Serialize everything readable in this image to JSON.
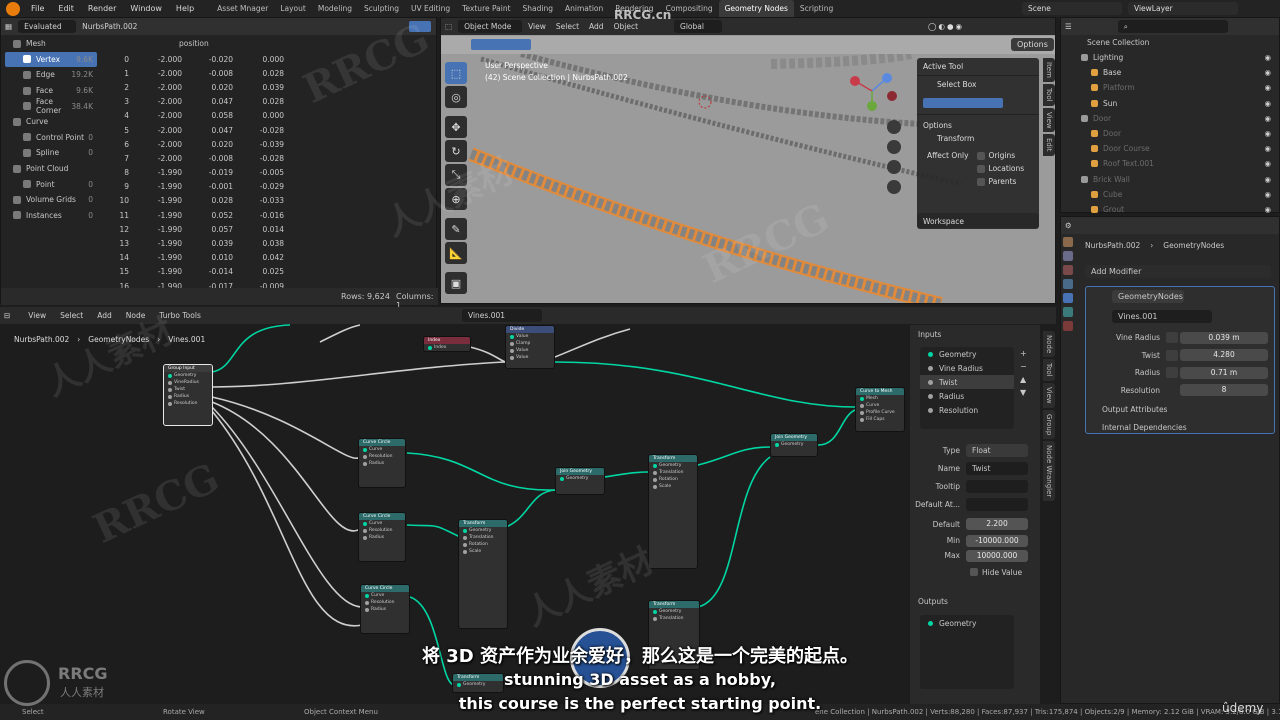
{
  "menu": [
    "File",
    "Edit",
    "Render",
    "Window",
    "Help"
  ],
  "workspaces": [
    "Asset Mnager",
    "Layout",
    "Modeling",
    "Sculpting",
    "UV Editing",
    "Texture Paint",
    "Shading",
    "Animation",
    "Rendering",
    "Compositing",
    "Geometry Nodes",
    "Scripting"
  ],
  "active_workspace": "Geometry Nodes",
  "scene": "Scene",
  "view_layer": "ViewLayer",
  "spreadsheet": {
    "mode": "Evaluated",
    "object": "NurbsPath.002",
    "column": "position",
    "tree": [
      {
        "label": "Mesh",
        "count": "",
        "level": 0
      },
      {
        "label": "Vertex",
        "count": "9.6K",
        "level": 1,
        "selected": true
      },
      {
        "label": "Edge",
        "count": "19.2K",
        "level": 1
      },
      {
        "label": "Face",
        "count": "9.6K",
        "level": 1
      },
      {
        "label": "Face Corner",
        "count": "38.4K",
        "level": 1
      },
      {
        "label": "Curve",
        "count": "",
        "level": 0
      },
      {
        "label": "Control Point",
        "count": "0",
        "level": 1
      },
      {
        "label": "Spline",
        "count": "0",
        "level": 1
      },
      {
        "label": "Point Cloud",
        "count": "",
        "level": 0
      },
      {
        "label": "Point",
        "count": "0",
        "level": 1
      },
      {
        "label": "Volume Grids",
        "count": "0",
        "level": 0
      },
      {
        "label": "Instances",
        "count": "0",
        "level": 0
      }
    ],
    "rows": [
      [
        "0",
        "-2.000",
        "-0.020",
        "0.000"
      ],
      [
        "1",
        "-2.000",
        "-0.008",
        "0.028"
      ],
      [
        "2",
        "-2.000",
        "0.020",
        "0.039"
      ],
      [
        "3",
        "-2.000",
        "0.047",
        "0.028"
      ],
      [
        "4",
        "-2.000",
        "0.058",
        "0.000"
      ],
      [
        "5",
        "-2.000",
        "0.047",
        "-0.028"
      ],
      [
        "6",
        "-2.000",
        "0.020",
        "-0.039"
      ],
      [
        "7",
        "-2.000",
        "-0.008",
        "-0.028"
      ],
      [
        "8",
        "-1.990",
        "-0.019",
        "-0.005"
      ],
      [
        "9",
        "-1.990",
        "-0.001",
        "-0.029"
      ],
      [
        "10",
        "-1.990",
        "0.028",
        "-0.033"
      ],
      [
        "11",
        "-1.990",
        "0.052",
        "-0.016"
      ],
      [
        "12",
        "-1.990",
        "0.057",
        "0.014"
      ],
      [
        "13",
        "-1.990",
        "0.039",
        "0.038"
      ],
      [
        "14",
        "-1.990",
        "0.010",
        "0.042"
      ],
      [
        "15",
        "-1.990",
        "-0.014",
        "0.025"
      ],
      [
        "16",
        "-1.990",
        "-0.017",
        "-0.009"
      ]
    ],
    "rows_count": "Rows: 9,624",
    "columns_count": "Columns: 1"
  },
  "viewport": {
    "mode": "Object Mode",
    "menu": [
      "View",
      "Select",
      "Add",
      "Object"
    ],
    "orientation": "Global",
    "options": "Options",
    "perspective": "User Perspective",
    "collection_line": "(42) Scene Collection | NurbsPath.002",
    "active_tool_title": "Active Tool",
    "active_tool": "Select Box",
    "options_title": "Options",
    "transform": "Transform",
    "affect_only": "Affect Only",
    "checks": [
      "Origins",
      "Locations",
      "Parents"
    ],
    "workspace": "Workspace",
    "side_tabs": [
      "Item",
      "Tool",
      "View",
      "Edit"
    ]
  },
  "outliner": {
    "title": "Scene Collection",
    "items": [
      {
        "label": "Lighting",
        "level": 1,
        "dim": false
      },
      {
        "label": "Base",
        "level": 2,
        "dim": false
      },
      {
        "label": "Platform",
        "level": 2,
        "dim": true
      },
      {
        "label": "Sun",
        "level": 2,
        "dim": false
      },
      {
        "label": "Door",
        "level": 1,
        "dim": true
      },
      {
        "label": "Door",
        "level": 2,
        "dim": true
      },
      {
        "label": "Door Course",
        "level": 2,
        "dim": true
      },
      {
        "label": "Roof Text.001",
        "level": 2,
        "dim": true
      },
      {
        "label": "Brick Wall",
        "level": 1,
        "dim": true
      },
      {
        "label": "Cube",
        "level": 2,
        "dim": true
      },
      {
        "label": "Grout",
        "level": 2,
        "dim": true
      }
    ]
  },
  "properties": {
    "object": "NurbsPath.002",
    "modifier_name": "GeometryNodes",
    "add_modifier": "Add Modifier",
    "node_group": "Vines.001",
    "params": [
      {
        "label": "Vine Radius",
        "value": "0.039 m"
      },
      {
        "label": "Twist",
        "value": "4.280"
      },
      {
        "label": "Radius",
        "value": "0.71 m"
      },
      {
        "label": "Resolution",
        "value": "8"
      }
    ],
    "output_attributes": "Output Attributes",
    "internal_dependencies": "Internal Dependencies"
  },
  "node_editor": {
    "menu": [
      "View",
      "Select",
      "Add",
      "Node",
      "Turbo Tools"
    ],
    "breadcrumb": [
      "NurbsPath.002",
      "GeometryNodes",
      "Vines.001"
    ],
    "group_name": "Vines.001",
    "nodes": [
      {
        "title": "Group Input",
        "color": "#3b3b3b",
        "sockets": [
          "Geometry",
          "VineRadius",
          "Twist",
          "Radius",
          "Resolution"
        ]
      },
      {
        "title": "Curve Circle",
        "color": "#2d6b6b",
        "sockets": [
          "Curve",
          "Resolution",
          "Radius"
        ]
      },
      {
        "title": "Curve Circle",
        "color": "#2d6b6b",
        "sockets": [
          "Curve",
          "Resolution",
          "Radius"
        ]
      },
      {
        "title": "Curve Circle",
        "color": "#2d6b6b",
        "sockets": [
          "Curve",
          "Resolution",
          "Radius"
        ]
      },
      {
        "title": "Join Geometry",
        "color": "#2d6b6b",
        "sockets": [
          "Geometry"
        ]
      },
      {
        "title": "Transform",
        "color": "#2d6b6b",
        "sockets": [
          "Geometry",
          "Translation",
          "Rotation",
          "Scale"
        ]
      },
      {
        "title": "Transform",
        "color": "#2d6b6b",
        "sockets": [
          "Geometry",
          "Translation",
          "Rotation",
          "Scale"
        ]
      },
      {
        "title": "Transform",
        "color": "#2d6b6b",
        "sockets": [
          "Geometry",
          "Translation"
        ]
      },
      {
        "title": "Join Geometry",
        "color": "#2d6b6b",
        "sockets": [
          "Geometry"
        ]
      },
      {
        "title": "Curve to Mesh",
        "color": "#2d6b6b",
        "sockets": [
          "Mesh",
          "Curve",
          "Profile Curve",
          "Fill Caps"
        ]
      },
      {
        "title": "Divide",
        "color": "#3d4d7a",
        "sockets": [
          "Value",
          "Clamp",
          "Value",
          "Value"
        ]
      },
      {
        "title": "Index",
        "color": "#7a2d3d",
        "sockets": [
          "Index"
        ]
      },
      {
        "title": "Transform",
        "color": "#2d6b6b",
        "sockets": [
          "Geometry"
        ]
      }
    ],
    "side_tabs": [
      "Node",
      "Tool",
      "View",
      "Group",
      "Node Wrangler"
    ],
    "inputs_title": "Inputs",
    "inputs": [
      "Geometry",
      "Vine Radius",
      "Twist",
      "Radius",
      "Resolution"
    ],
    "selected_input": "Twist",
    "type_label": "Type",
    "type_value": "Float",
    "name_label": "Name",
    "name_value": "Twist",
    "tooltip_label": "Tooltip",
    "default_attr_label": "Default At...",
    "default_label": "Default",
    "default_value": "2.200",
    "min_label": "Min",
    "min_value": "-10000.000",
    "max_label": "Max",
    "max_value": "10000.000",
    "hide_value": "Hide Value",
    "outputs_title": "Outputs",
    "outputs": [
      "Geometry"
    ]
  },
  "statusbar": {
    "select": "Select",
    "rotate": "Rotate View",
    "context": "Object Context Menu",
    "stats": "ene Collection | NurbsPath.002 | Verts:88,280 | Faces:87,937 | Tris:175,874 | Objects:2/9 | Memory: 2.12 GiB | VRAM: 3.2/8.0 GiB | 3.1.0"
  },
  "subtitles": {
    "cn": "将 3D 资产作为业余爱好，那么这是一个完美的起点。",
    "en1": "stunning 3D asset as a hobby,",
    "en2": "this course is the perfect starting point."
  },
  "watermarks": {
    "site": "RRCG.cn",
    "brand": "RRCG",
    "cn": "人人素材"
  },
  "udemy": "ûdemy",
  "colors": {
    "accent": "#4772b3",
    "node_link": "#00d6a3",
    "selection_orange": "#e08a3c"
  }
}
